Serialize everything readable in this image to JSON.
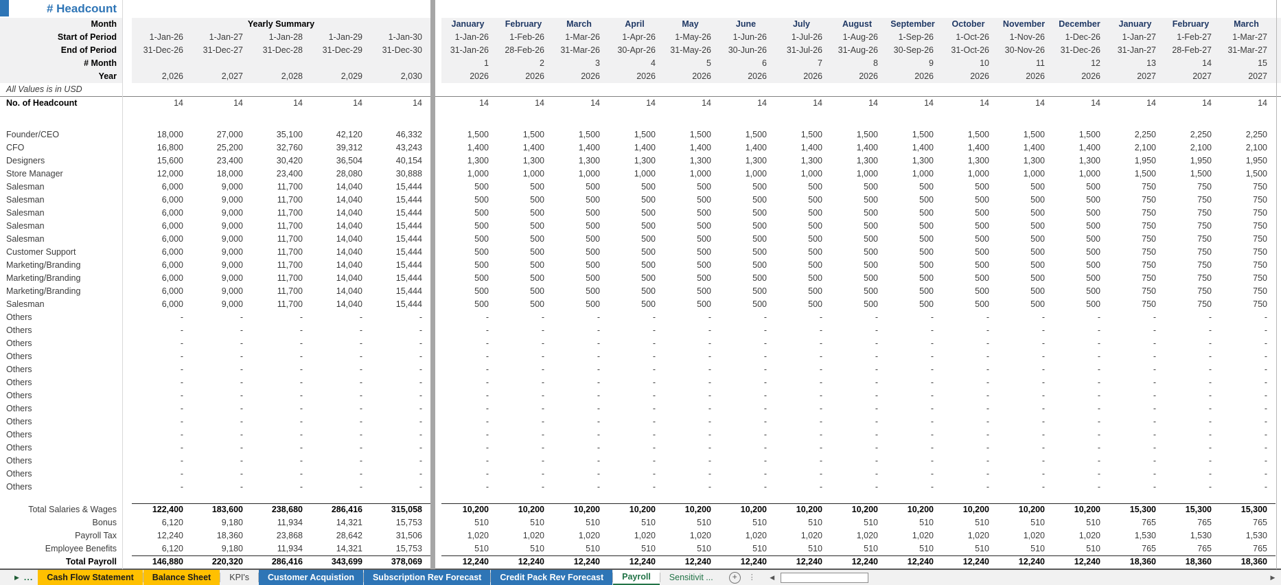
{
  "title": "# Headcount",
  "note": "All Values is in USD",
  "colors": {
    "title_blue": "#2E75B6",
    "month_navy": "#1F3864",
    "header_bg": "#F1F1F2",
    "pane_divider": "#A6A6A6",
    "tab_orange": "#FFC000",
    "tab_blue": "#2E75B6",
    "excel_green": "#217346"
  },
  "header": {
    "row_labels": {
      "month": "Month",
      "start": "Start of Period",
      "end": "End of Period",
      "num": "# Month",
      "year": "Year"
    },
    "yearly_title": "Yearly Summary",
    "yearly": {
      "start": [
        "1-Jan-26",
        "1-Jan-27",
        "1-Jan-28",
        "1-Jan-29",
        "1-Jan-30"
      ],
      "end": [
        "31-Dec-26",
        "31-Dec-27",
        "31-Dec-28",
        "31-Dec-29",
        "31-Dec-30"
      ],
      "num": [
        "",
        "",
        "",
        "",
        ""
      ],
      "year": [
        "2,026",
        "2,027",
        "2,028",
        "2,029",
        "2,030"
      ]
    },
    "monthly": {
      "names": [
        "January",
        "February",
        "March",
        "April",
        "May",
        "June",
        "July",
        "August",
        "September",
        "October",
        "November",
        "December",
        "January",
        "February",
        "March"
      ],
      "start": [
        "1-Jan-26",
        "1-Feb-26",
        "1-Mar-26",
        "1-Apr-26",
        "1-May-26",
        "1-Jun-26",
        "1-Jul-26",
        "1-Aug-26",
        "1-Sep-26",
        "1-Oct-26",
        "1-Nov-26",
        "1-Dec-26",
        "1-Jan-27",
        "1-Feb-27",
        "1-Mar-27"
      ],
      "end": [
        "31-Jan-26",
        "28-Feb-26",
        "31-Mar-26",
        "30-Apr-26",
        "31-May-26",
        "30-Jun-26",
        "31-Jul-26",
        "31-Aug-26",
        "30-Sep-26",
        "31-Oct-26",
        "30-Nov-26",
        "31-Dec-26",
        "31-Jan-27",
        "28-Feb-27",
        "31-Mar-27"
      ],
      "num": [
        "1",
        "2",
        "3",
        "4",
        "5",
        "6",
        "7",
        "8",
        "9",
        "10",
        "11",
        "12",
        "13",
        "14",
        "15"
      ],
      "year": [
        "2026",
        "2026",
        "2026",
        "2026",
        "2026",
        "2026",
        "2026",
        "2026",
        "2026",
        "2026",
        "2026",
        "2026",
        "2027",
        "2027",
        "2027"
      ]
    }
  },
  "headcount": {
    "label": "No. of Headcount",
    "yearly": [
      "14",
      "14",
      "14",
      "14",
      "14"
    ],
    "monthly": [
      "14",
      "14",
      "14",
      "14",
      "14",
      "14",
      "14",
      "14",
      "14",
      "14",
      "14",
      "14",
      "14",
      "14",
      "14"
    ]
  },
  "employee_rows": [
    {
      "label": "Founder/CEO",
      "yearly": [
        "18,000",
        "27,000",
        "35,100",
        "42,120",
        "46,332"
      ],
      "monthly": [
        "1,500",
        "1,500",
        "1,500",
        "1,500",
        "1,500",
        "1,500",
        "1,500",
        "1,500",
        "1,500",
        "1,500",
        "1,500",
        "1,500",
        "2,250",
        "2,250",
        "2,250"
      ]
    },
    {
      "label": "CFO",
      "yearly": [
        "16,800",
        "25,200",
        "32,760",
        "39,312",
        "43,243"
      ],
      "monthly": [
        "1,400",
        "1,400",
        "1,400",
        "1,400",
        "1,400",
        "1,400",
        "1,400",
        "1,400",
        "1,400",
        "1,400",
        "1,400",
        "1,400",
        "2,100",
        "2,100",
        "2,100"
      ]
    },
    {
      "label": "Designers",
      "yearly": [
        "15,600",
        "23,400",
        "30,420",
        "36,504",
        "40,154"
      ],
      "monthly": [
        "1,300",
        "1,300",
        "1,300",
        "1,300",
        "1,300",
        "1,300",
        "1,300",
        "1,300",
        "1,300",
        "1,300",
        "1,300",
        "1,300",
        "1,950",
        "1,950",
        "1,950"
      ]
    },
    {
      "label": "Store Manager",
      "yearly": [
        "12,000",
        "18,000",
        "23,400",
        "28,080",
        "30,888"
      ],
      "monthly": [
        "1,000",
        "1,000",
        "1,000",
        "1,000",
        "1,000",
        "1,000",
        "1,000",
        "1,000",
        "1,000",
        "1,000",
        "1,000",
        "1,000",
        "1,500",
        "1,500",
        "1,500"
      ]
    },
    {
      "label": "Salesman",
      "yearly": [
        "6,000",
        "9,000",
        "11,700",
        "14,040",
        "15,444"
      ],
      "monthly": [
        "500",
        "500",
        "500",
        "500",
        "500",
        "500",
        "500",
        "500",
        "500",
        "500",
        "500",
        "500",
        "750",
        "750",
        "750"
      ]
    },
    {
      "label": "Salesman",
      "yearly": [
        "6,000",
        "9,000",
        "11,700",
        "14,040",
        "15,444"
      ],
      "monthly": [
        "500",
        "500",
        "500",
        "500",
        "500",
        "500",
        "500",
        "500",
        "500",
        "500",
        "500",
        "500",
        "750",
        "750",
        "750"
      ]
    },
    {
      "label": "Salesman",
      "yearly": [
        "6,000",
        "9,000",
        "11,700",
        "14,040",
        "15,444"
      ],
      "monthly": [
        "500",
        "500",
        "500",
        "500",
        "500",
        "500",
        "500",
        "500",
        "500",
        "500",
        "500",
        "500",
        "750",
        "750",
        "750"
      ]
    },
    {
      "label": "Salesman",
      "yearly": [
        "6,000",
        "9,000",
        "11,700",
        "14,040",
        "15,444"
      ],
      "monthly": [
        "500",
        "500",
        "500",
        "500",
        "500",
        "500",
        "500",
        "500",
        "500",
        "500",
        "500",
        "500",
        "750",
        "750",
        "750"
      ]
    },
    {
      "label": "Salesman",
      "yearly": [
        "6,000",
        "9,000",
        "11,700",
        "14,040",
        "15,444"
      ],
      "monthly": [
        "500",
        "500",
        "500",
        "500",
        "500",
        "500",
        "500",
        "500",
        "500",
        "500",
        "500",
        "500",
        "750",
        "750",
        "750"
      ]
    },
    {
      "label": "Customer Support",
      "yearly": [
        "6,000",
        "9,000",
        "11,700",
        "14,040",
        "15,444"
      ],
      "monthly": [
        "500",
        "500",
        "500",
        "500",
        "500",
        "500",
        "500",
        "500",
        "500",
        "500",
        "500",
        "500",
        "750",
        "750",
        "750"
      ]
    },
    {
      "label": "Marketing/Branding",
      "yearly": [
        "6,000",
        "9,000",
        "11,700",
        "14,040",
        "15,444"
      ],
      "monthly": [
        "500",
        "500",
        "500",
        "500",
        "500",
        "500",
        "500",
        "500",
        "500",
        "500",
        "500",
        "500",
        "750",
        "750",
        "750"
      ]
    },
    {
      "label": "Marketing/Branding",
      "yearly": [
        "6,000",
        "9,000",
        "11,700",
        "14,040",
        "15,444"
      ],
      "monthly": [
        "500",
        "500",
        "500",
        "500",
        "500",
        "500",
        "500",
        "500",
        "500",
        "500",
        "500",
        "500",
        "750",
        "750",
        "750"
      ]
    },
    {
      "label": "Marketing/Branding",
      "yearly": [
        "6,000",
        "9,000",
        "11,700",
        "14,040",
        "15,444"
      ],
      "monthly": [
        "500",
        "500",
        "500",
        "500",
        "500",
        "500",
        "500",
        "500",
        "500",
        "500",
        "500",
        "500",
        "750",
        "750",
        "750"
      ]
    },
    {
      "label": "Salesman",
      "yearly": [
        "6,000",
        "9,000",
        "11,700",
        "14,040",
        "15,444"
      ],
      "monthly": [
        "500",
        "500",
        "500",
        "500",
        "500",
        "500",
        "500",
        "500",
        "500",
        "500",
        "500",
        "500",
        "750",
        "750",
        "750"
      ]
    }
  ],
  "others": {
    "label": "Others",
    "count": 14,
    "yearly": [
      "-",
      "-",
      "-",
      "-",
      "-"
    ],
    "monthly": [
      "-",
      "-",
      "-",
      "-",
      "-",
      "-",
      "-",
      "-",
      "-",
      "-",
      "-",
      "-",
      "-",
      "-",
      "-"
    ]
  },
  "totals": [
    {
      "label": "Total Salaries & Wages",
      "bold": true,
      "yearly": [
        "122,400",
        "183,600",
        "238,680",
        "286,416",
        "315,058"
      ],
      "monthly": [
        "10,200",
        "10,200",
        "10,200",
        "10,200",
        "10,200",
        "10,200",
        "10,200",
        "10,200",
        "10,200",
        "10,200",
        "10,200",
        "10,200",
        "15,300",
        "15,300",
        "15,300"
      ]
    },
    {
      "label": "Bonus",
      "yearly": [
        "6,120",
        "9,180",
        "11,934",
        "14,321",
        "15,753"
      ],
      "monthly": [
        "510",
        "510",
        "510",
        "510",
        "510",
        "510",
        "510",
        "510",
        "510",
        "510",
        "510",
        "510",
        "765",
        "765",
        "765"
      ]
    },
    {
      "label": "Payroll Tax",
      "yearly": [
        "12,240",
        "18,360",
        "23,868",
        "28,642",
        "31,506"
      ],
      "monthly": [
        "1,020",
        "1,020",
        "1,020",
        "1,020",
        "1,020",
        "1,020",
        "1,020",
        "1,020",
        "1,020",
        "1,020",
        "1,020",
        "1,020",
        "1,530",
        "1,530",
        "1,530"
      ]
    },
    {
      "label": "Employee Benefits",
      "yearly": [
        "6,120",
        "9,180",
        "11,934",
        "14,321",
        "15,753"
      ],
      "monthly": [
        "510",
        "510",
        "510",
        "510",
        "510",
        "510",
        "510",
        "510",
        "510",
        "510",
        "510",
        "510",
        "765",
        "765",
        "765"
      ]
    },
    {
      "label": "Total Payroll",
      "bold": true,
      "label_bold": true,
      "yearly": [
        "146,880",
        "220,320",
        "286,416",
        "343,699",
        "378,069"
      ],
      "monthly": [
        "12,240",
        "12,240",
        "12,240",
        "12,240",
        "12,240",
        "12,240",
        "12,240",
        "12,240",
        "12,240",
        "12,240",
        "12,240",
        "12,240",
        "18,360",
        "18,360",
        "18,360"
      ]
    }
  ],
  "tabbar": {
    "nav_arrow": "▶",
    "more": "...",
    "tabs": [
      {
        "label": "Cash Flow Statement",
        "style": "orange"
      },
      {
        "label": "Balance Sheet",
        "style": "orange"
      },
      {
        "label": "KPI's",
        "style": "plain"
      },
      {
        "label": "Customer Acquistion",
        "style": "blue"
      },
      {
        "label": "Subscription Rev Forecast",
        "style": "blue"
      },
      {
        "label": "Credit Pack Rev Forecast",
        "style": "blue"
      },
      {
        "label": "Payroll",
        "style": "active"
      },
      {
        "label": "Sensitivit ...",
        "style": "green"
      }
    ],
    "add_icon": "+",
    "menu_icon": "⋮",
    "scroll_left": "◀",
    "scroll_right": "▶"
  }
}
